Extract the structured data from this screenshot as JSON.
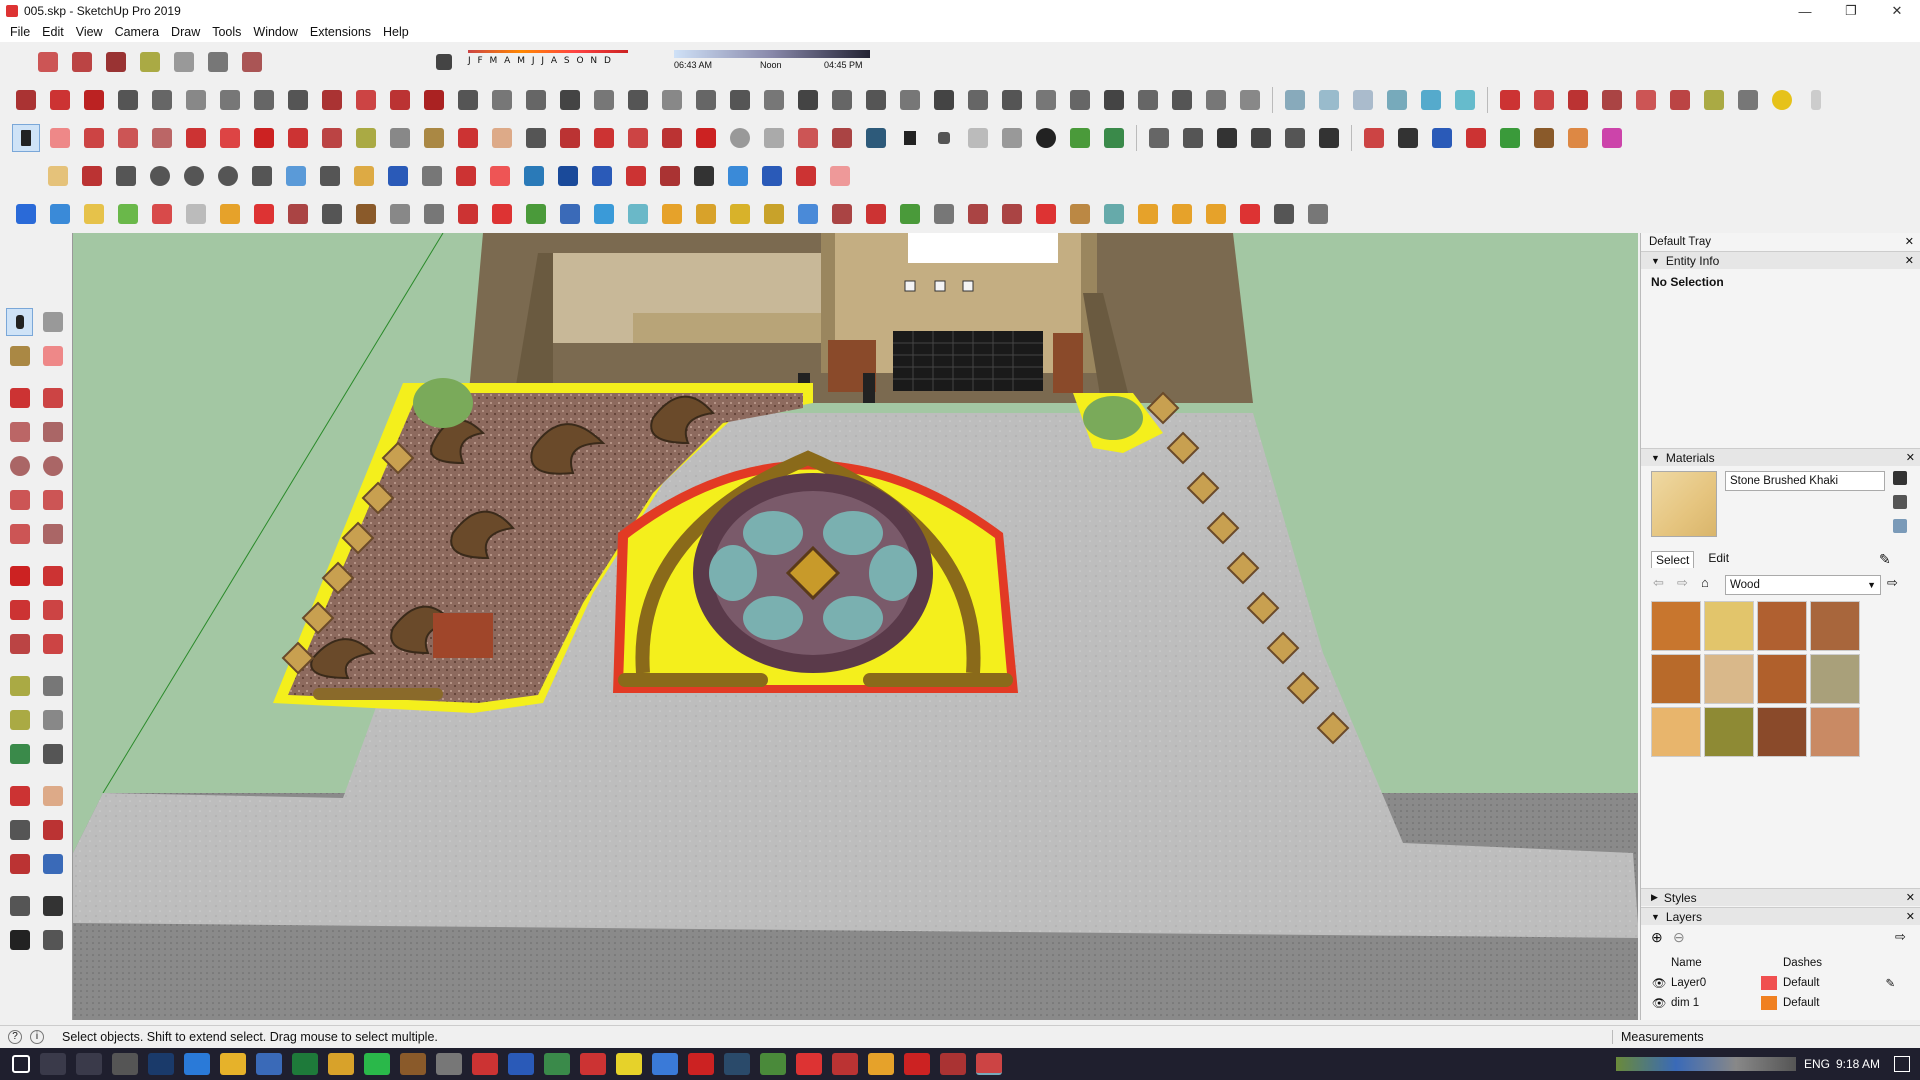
{
  "window": {
    "title": "005.skp - SketchUp Pro 2019",
    "controls": [
      "—",
      "❐",
      "✕"
    ]
  },
  "menu": [
    "File",
    "Edit",
    "View",
    "Camera",
    "Draw",
    "Tools",
    "Window",
    "Extensions",
    "Help"
  ],
  "shadow_settings": {
    "months": "J F M A M J J A S O N D",
    "time_start": "06:43 AM",
    "time_mid": "Noon",
    "time_end": "04:45 PM"
  },
  "tray": {
    "title": "Default Tray",
    "entity_info": {
      "label": "Entity Info",
      "selection": "No Selection"
    },
    "materials": {
      "label": "Materials",
      "current_material": "Stone Brushed Khaki",
      "tabs": [
        "Select",
        "Edit"
      ],
      "library": "Wood",
      "swatch_colors": [
        "#c8762e",
        "#e2c56b",
        "#b06030",
        "#a8663c",
        "#b86a2a",
        "#d9b88a",
        "#b0602c",
        "#a9a07a",
        "#e8b56c",
        "#8e8a34",
        "#8a4a2a",
        "#c98a64"
      ]
    },
    "styles": {
      "label": "Styles"
    },
    "layers": {
      "label": "Layers",
      "columns": [
        "Name",
        "Dashes"
      ],
      "rows": [
        {
          "name": "Layer0",
          "color": "#f05050",
          "dashes": "Default"
        },
        {
          "name": "dim 1",
          "color": "#f08020",
          "dashes": "Default"
        }
      ]
    }
  },
  "status": {
    "message": "Select objects. Shift to extend select. Drag mouse to select multiple.",
    "measurements_label": "Measurements"
  },
  "taskbar": {
    "language": "ENG",
    "clock": "9:18 AM"
  },
  "colors": {
    "ground": "#9cc59c",
    "paving": "#b9b9b9",
    "wall": "#b8a070",
    "flowerbed": "#f4ef1c",
    "accent_red": "#e23a24"
  }
}
